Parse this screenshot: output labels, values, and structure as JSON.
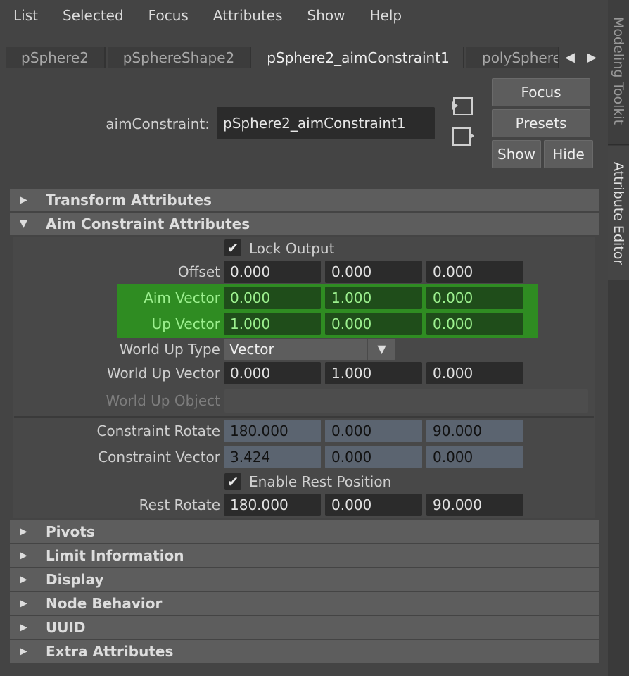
{
  "menu": [
    "List",
    "Selected",
    "Focus",
    "Attributes",
    "Show",
    "Help"
  ],
  "side_tabs": {
    "modeling": "Modeling Toolkit",
    "attribute_editor": "Attribute Editor"
  },
  "node_tabs": [
    "pSphere2",
    "pSphereShape2",
    "pSphere2_aimConstraint1",
    "polySphere"
  ],
  "header": {
    "node_type_label": "aimConstraint:",
    "node_name": "pSphere2_aimConstraint1",
    "focus_button": "Focus",
    "presets_button": "Presets",
    "show_button": "Show",
    "hide_button": "Hide"
  },
  "sections": {
    "transform": "Transform Attributes",
    "aim": "Aim Constraint Attributes",
    "pivots": "Pivots",
    "limit": "Limit Information",
    "display": "Display",
    "node_behavior": "Node Behavior",
    "uuid": "UUID",
    "extra": "Extra Attributes"
  },
  "aim": {
    "lock_output": {
      "label": "Lock Output",
      "checked": true
    },
    "offset": {
      "label": "Offset",
      "values": [
        "0.000",
        "0.000",
        "0.000"
      ]
    },
    "aim_vector": {
      "label": "Aim Vector",
      "values": [
        "0.000",
        "1.000",
        "0.000"
      ]
    },
    "up_vector": {
      "label": "Up Vector",
      "values": [
        "1.000",
        "0.000",
        "0.000"
      ]
    },
    "world_up_type": {
      "label": "World Up Type",
      "value": "Vector"
    },
    "world_up_vector": {
      "label": "World Up Vector",
      "values": [
        "0.000",
        "1.000",
        "0.000"
      ]
    },
    "world_up_object": {
      "label": "World Up Object",
      "value": ""
    },
    "constraint_rotate": {
      "label": "Constraint Rotate",
      "values": [
        "180.000",
        "0.000",
        "90.000"
      ]
    },
    "constraint_vector": {
      "label": "Constraint Vector",
      "values": [
        "3.424",
        "0.000",
        "0.000"
      ]
    },
    "enable_rest": {
      "label": "Enable Rest Position",
      "checked": true
    },
    "rest_rotate": {
      "label": "Rest Rotate",
      "values": [
        "180.000",
        "0.000",
        "90.000"
      ]
    }
  },
  "colors": {
    "highlight_green": "#2f8c22",
    "driven_blue": "#5b6470",
    "panel": "#444444"
  }
}
